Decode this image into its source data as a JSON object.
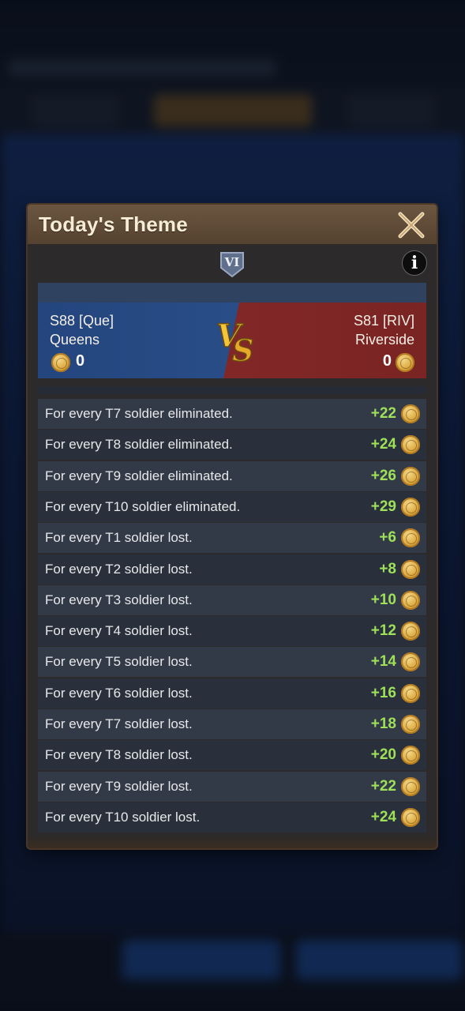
{
  "modal": {
    "title": "Today's Theme",
    "rank_badge": "VI",
    "info_label": "i"
  },
  "versus": {
    "left": {
      "server": "S88 [Que]",
      "name": "Queens",
      "score": "0",
      "color": "#24457e"
    },
    "right": {
      "server": "S81 [RIV]",
      "name": "Riverside",
      "score": "0",
      "color": "#8a2a2a"
    },
    "logo_text": "VS"
  },
  "rules": [
    {
      "label": "For every T7 soldier eliminated.",
      "value": "+22"
    },
    {
      "label": "For every T8 soldier eliminated.",
      "value": "+24"
    },
    {
      "label": "For every T9 soldier eliminated.",
      "value": "+26"
    },
    {
      "label": "For every T10 soldier eliminated.",
      "value": "+29"
    },
    {
      "label": "For every T1 soldier lost.",
      "value": "+6"
    },
    {
      "label": "For every T2 soldier lost.",
      "value": "+8"
    },
    {
      "label": "For every T3 soldier lost.",
      "value": "+10"
    },
    {
      "label": "For every T4 soldier lost.",
      "value": "+12"
    },
    {
      "label": "For every T5 soldier lost.",
      "value": "+14"
    },
    {
      "label": "For every T6 soldier lost.",
      "value": "+16"
    },
    {
      "label": "For every T7 soldier lost.",
      "value": "+18"
    },
    {
      "label": "For every T8 soldier lost.",
      "value": "+20"
    },
    {
      "label": "For every T9 soldier lost.",
      "value": "+22"
    },
    {
      "label": "For every T10 soldier lost.",
      "value": "+24"
    }
  ],
  "colors": {
    "value_green": "#9ee05a",
    "header_brown": "#6b5640",
    "coin_gold": "#d9a53a"
  },
  "icons": {
    "close": "close-x-icon",
    "info": "info-icon",
    "coin": "gold-coin-icon",
    "rank": "rank-badge-icon"
  }
}
